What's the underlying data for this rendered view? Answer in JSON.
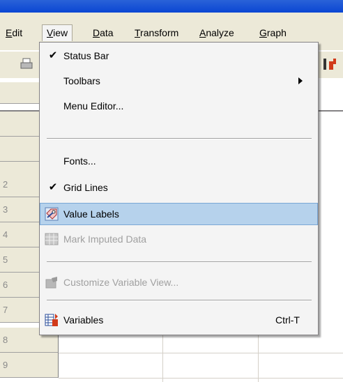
{
  "menubar": {
    "items": [
      {
        "label": "Edit",
        "key": "E"
      },
      {
        "label": "View",
        "key": "V"
      },
      {
        "label": "Data",
        "key": "D"
      },
      {
        "label": "Transform",
        "key": "T"
      },
      {
        "label": "Analyze",
        "key": "A"
      },
      {
        "label": "Graph",
        "key": "G"
      }
    ]
  },
  "row_headers": [
    "",
    "",
    "",
    "2",
    "3",
    "4",
    "5",
    "6",
    "7",
    "8",
    "9"
  ],
  "view_menu": {
    "items": [
      {
        "label": "Status Bar",
        "checked": true,
        "enabled": true
      },
      {
        "label": "Toolbars",
        "submenu": true,
        "enabled": true
      },
      {
        "label": "Menu Editor...",
        "enabled": true
      },
      {
        "label": "Fonts...",
        "enabled": true
      },
      {
        "label": "Grid Lines",
        "checked": true,
        "enabled": true
      },
      {
        "label": "Value Labels",
        "enabled": true,
        "highlighted": true,
        "icon": "value-labels-icon"
      },
      {
        "label": "Mark Imputed Data",
        "enabled": false,
        "icon": "grid-icon"
      },
      {
        "label": "Customize Variable View...",
        "enabled": false,
        "icon": "customize-icon"
      },
      {
        "label": "Variables",
        "enabled": true,
        "shortcut": "Ctrl-T",
        "icon": "variables-icon"
      }
    ]
  },
  "glyphs": {
    "check": "✔"
  },
  "colors": {
    "highlight": "#b6d2ec",
    "title_bar": "#0a46d3",
    "chrome": "#ece9d8"
  }
}
